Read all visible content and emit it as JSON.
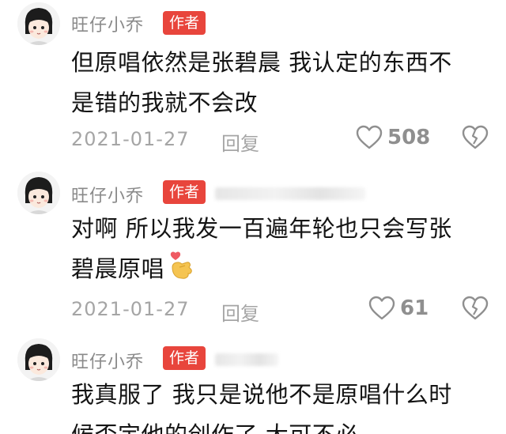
{
  "comments": [
    {
      "username": "旺仔小乔",
      "badge": "作者",
      "lines": [
        "但原唱依然是张碧晨 我认定的东西不",
        "是错的我就不会改"
      ],
      "date": "2021-01-27",
      "reply_label": "回复",
      "likes": "508",
      "has_reply_target": false
    },
    {
      "username": "旺仔小乔",
      "badge": "作者",
      "lines": [
        "对啊 所以我发一百遍年轮也只会写张",
        "碧晨原唱"
      ],
      "date": "2021-01-27",
      "reply_label": "回复",
      "likes": "61",
      "has_reply_target": true,
      "emoji": "heart-hand-emoji"
    },
    {
      "username": "旺仔小乔",
      "badge": "作者",
      "lines": [
        "我真服了 我只是说他不是原唱什么时",
        "候否定他的创作了 大可不必"
      ],
      "has_reply_target": true
    }
  ],
  "icons": {
    "like": "heart-outline-icon",
    "dislike": "broken-heart-icon"
  },
  "colors": {
    "badge": "#e8453c",
    "meta_text": "#a5a5a5",
    "username": "#8a8a8a"
  }
}
